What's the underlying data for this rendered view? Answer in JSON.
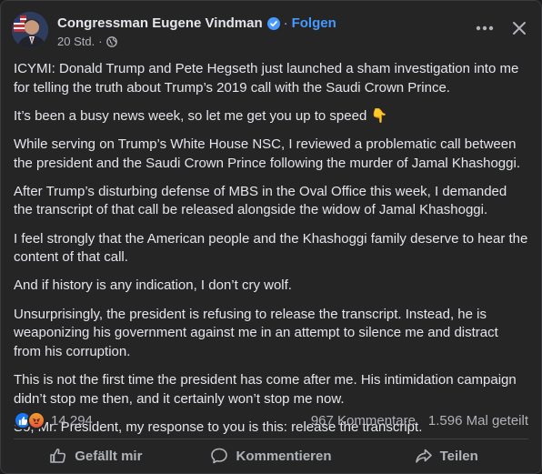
{
  "post": {
    "author": "Congressman Eugene Vindman",
    "follow_label": "Folgen",
    "separator": "·",
    "time": "20 Std.",
    "icons": {
      "verified": "verified-badge-icon",
      "audience": "globe-icon",
      "more": "more-dots-icon",
      "close": "close-icon"
    },
    "paragraphs": [
      "ICYMI: Donald Trump and Pete Hegseth just launched a sham investigation into me for telling the truth about Trump’s 2019 call with the Saudi Crown Prince.",
      "It’s been a busy news week, so let me get you up to speed 👇",
      "While serving on Trump’s White House NSC, I reviewed a problematic call between the president and the Saudi Crown Prince following the murder of Jamal Khashoggi.",
      "After Trump’s disturbing defense of MBS in the Oval Office this week, I demanded the transcript of that call be released alongside the widow of Jamal Khashoggi.",
      "I feel strongly that the American people and the Khashoggi family deserve to hear the content of that call.",
      "And if history is any indication, I don’t cry wolf.",
      "Unsurprisingly, the president is refusing to release the transcript. Instead, he is weaponizing his government against me in an attempt to silence me and distract from his corruption.",
      "This is not the first time the president has come after me. His intimidation campaign didn’t stop me then, and it certainly won’t stop me now.",
      "So, Mr. President, my response to you is this: release the transcript."
    ]
  },
  "stats": {
    "reactions": [
      "like-reaction-icon",
      "angry-reaction-icon"
    ],
    "reaction_count": "14.294",
    "comments": "967 Kommentare",
    "shares": "1.596 Mal geteilt"
  },
  "actions": {
    "like": "Gefällt mir",
    "comment": "Kommentieren",
    "share": "Teilen"
  },
  "colors": {
    "background": "#252526",
    "text": "#e4e6eb",
    "muted": "#b0b3b8",
    "accent": "#4599ff",
    "like_blue": "#1877f2"
  }
}
